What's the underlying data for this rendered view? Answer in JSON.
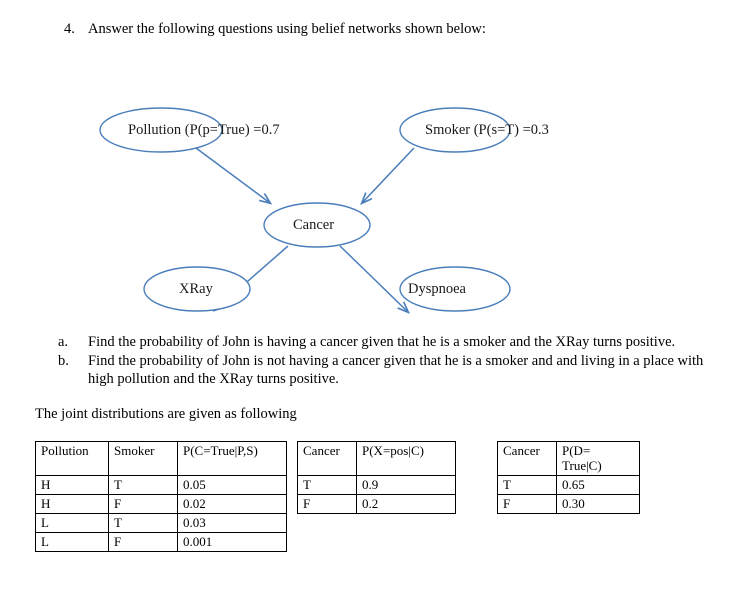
{
  "question": {
    "number": "4.",
    "text": "Answer the following questions using belief networks shown below:"
  },
  "network": {
    "node_color": "#4a7ebb",
    "nodes": [
      {
        "id": "pollution",
        "label": "Pollution (P(p=True) =0.7"
      },
      {
        "id": "smoker",
        "label": "Smoker (P(s=T) =0.3"
      },
      {
        "id": "cancer",
        "label": "Cancer"
      },
      {
        "id": "xray",
        "label": "XRay"
      },
      {
        "id": "dyspnoea",
        "label": "Dyspnoea"
      }
    ],
    "edges": [
      {
        "from": "pollution",
        "to": "cancer"
      },
      {
        "from": "smoker",
        "to": "cancer"
      },
      {
        "from": "cancer",
        "to": "xray"
      },
      {
        "from": "cancer",
        "to": "dyspnoea"
      }
    ]
  },
  "sub_questions": [
    {
      "marker": "a.",
      "text": "Find the probability of John is having a cancer given that he is a smoker and the XRay turns positive."
    },
    {
      "marker": "b.",
      "text": "Find the probability of John is not having a cancer given that he is a smoker and and living in a place with high pollution and the XRay turns positive."
    }
  ],
  "joint_note": "The joint distributions are given as following",
  "tables": {
    "cancer_cpt": {
      "headers": [
        "Pollution",
        "Smoker",
        "P(C=True|P,S)"
      ],
      "rows": [
        [
          "H",
          "T",
          "0.05"
        ],
        [
          "H",
          "F",
          "0.02"
        ],
        [
          "L",
          "T",
          "0.03"
        ],
        [
          "L",
          "F",
          "0.001"
        ]
      ]
    },
    "xray_cpt": {
      "headers": [
        "Cancer",
        "P(X=pos|C)"
      ],
      "rows": [
        [
          "T",
          "0.9"
        ],
        [
          "F",
          "0.2"
        ]
      ]
    },
    "dyspnoea_cpt": {
      "headers": [
        "Cancer",
        "P(D=\nTrue|C)"
      ],
      "header_line1": "P(D=",
      "header_line2": "True|C)",
      "rows": [
        [
          "T",
          "0.65"
        ],
        [
          "F",
          "0.30"
        ]
      ]
    }
  }
}
